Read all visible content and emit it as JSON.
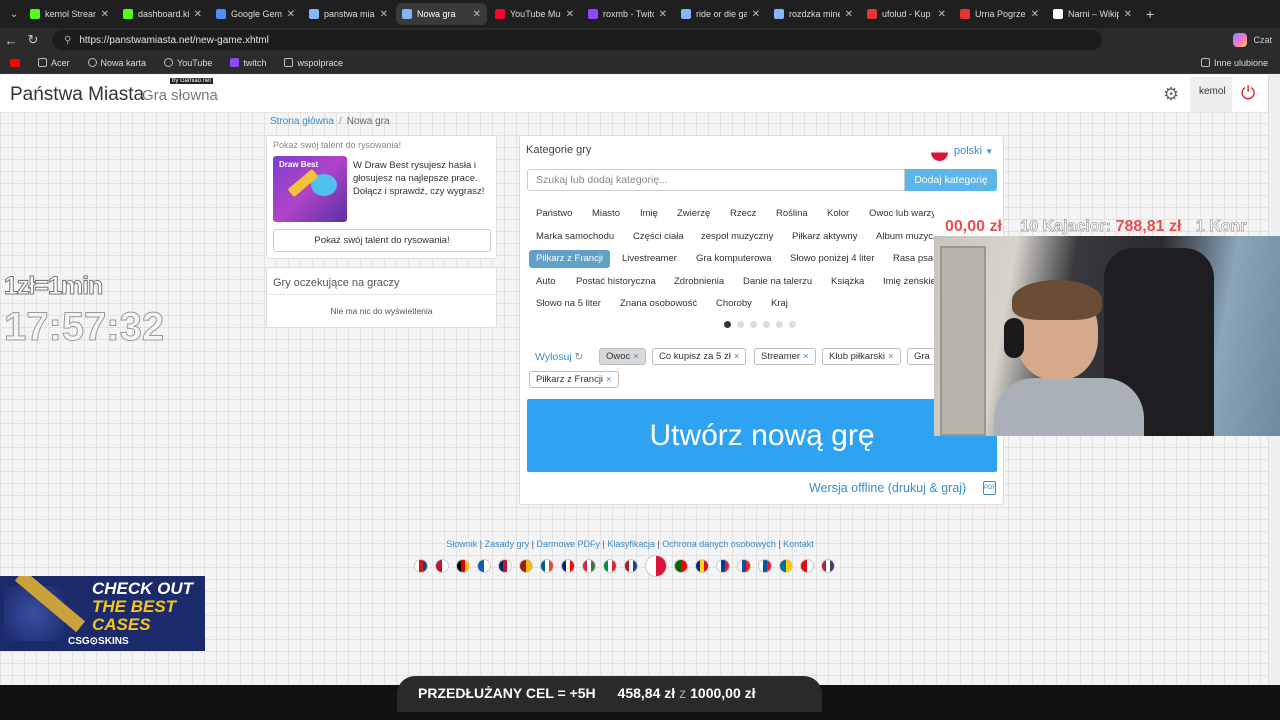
{
  "browser": {
    "tabs": [
      {
        "label": "kemol Stream",
        "color": "#53fc18"
      },
      {
        "label": "dashboard.kick",
        "color": "#53fc18"
      },
      {
        "label": "Google Gemini",
        "color": "#4f8df5"
      },
      {
        "label": "panstwa miasta",
        "color": "#8ab4f8"
      },
      {
        "label": "Nowa gra",
        "color": "#8ab4f8"
      },
      {
        "label": "YouTube Music",
        "color": "#ff0033"
      },
      {
        "label": "roxmb - Twitch",
        "color": "#9146ff"
      },
      {
        "label": "ride or die gam",
        "color": "#8ab4f8"
      },
      {
        "label": "rozdzka mineci",
        "color": "#8ab4f8"
      },
      {
        "label": "ufolud - Kup ul",
        "color": "#e53238"
      },
      {
        "label": "Urna Pogrzebo",
        "color": "#e53238"
      },
      {
        "label": "Narni – Wikipe",
        "color": "#ffffff"
      }
    ],
    "active_tab": 4,
    "url": "https://panstwamiasta.net/new-game.xhtml",
    "profile_label": "Czat",
    "bookmarks": [
      "Acer",
      "Nowa karta",
      "YouTube",
      "twitch",
      "wspolprace"
    ],
    "other_bookmarks": "Inne ulubione"
  },
  "site": {
    "brand": "Państwa Miasta",
    "brand_sub": "Gra słowna",
    "by": "by Gamiao.net",
    "user": "kemol"
  },
  "breadcrumb": {
    "home": "Strona główna",
    "current": "Nowa gra"
  },
  "draw_promo": {
    "title": "Pokaż swój talent do rysowania!",
    "image_label": "Draw Best",
    "text": "W Draw Best rysujesz hasła i głosujesz na najlepsze prace. Dołącz i sprawdź, czy wygrasz!",
    "button": "Pokaż swój talent do rysowania!"
  },
  "waiting": {
    "title": "Gry oczekujące na graczy",
    "empty": "Nie ma nic do wyświetlenia"
  },
  "categories_panel": {
    "title": "Kategorie gry",
    "language": "polski",
    "search_placeholder": "Szukaj lub dodaj kategorię...",
    "add_button": "Dodaj kategorię",
    "categories": [
      "Państwo",
      "Miasto",
      "Imię",
      "Zwierzę",
      "Rzecz",
      "Roślina",
      "Kolor",
      "Owoc lub warzywo",
      "Marka samochodu",
      "Części ciała",
      "zespol muzyczny",
      "Piłkarz aktywny",
      "Album muzyczny",
      "Piłkarz z Francji",
      "Livestreamer",
      "Gra komputerowa",
      "Słowo poniżej 4 liter",
      "Rasa psa",
      "Auto",
      "Postać historyczna",
      "Zdrobnienia",
      "Danie na talerzu",
      "Książka",
      "Imię żeńskie",
      "Słowo na 5 liter",
      "Znana osobowość",
      "Choroby",
      "Kraj"
    ],
    "selected_category": "Piłkarz z Francji",
    "draw_label": "Wylosuj",
    "chosen": [
      "Owoc",
      "Co kupisz za 5 zł",
      "Streamer",
      "Klub piłkarski",
      "Gra",
      "Piłkarz z Francji"
    ],
    "create_button": "Utwórz nową grę",
    "offline_link": "Wersja offline (drukuj & graj)",
    "pdf_label": "PDF"
  },
  "footer": {
    "links": [
      "Słownik",
      "Zasady gry",
      "Darmowe PDFy",
      "Klasyfikacja",
      "Ochrona danych osobowych",
      "Kontakt"
    ]
  },
  "overlay": {
    "rate": "1zł=1min",
    "timer": "17:57:32",
    "ticker_amount1": "00,00 zł",
    "ticker_rank": "10",
    "ticker_name": "Kajacior:",
    "ticker_amount2": "788,81 zł",
    "ticker_next": "1 Konr",
    "ad_line1": "CHECK OUT",
    "ad_line2": "THE BEST",
    "ad_line3": "CASES",
    "ad_logo": "CSG⊙SKINS",
    "goal_label": "PRZEDŁUŻANY CEL = +5H",
    "goal_current": "458,84 zł",
    "goal_of": "z",
    "goal_target": "1000,00 zł"
  }
}
